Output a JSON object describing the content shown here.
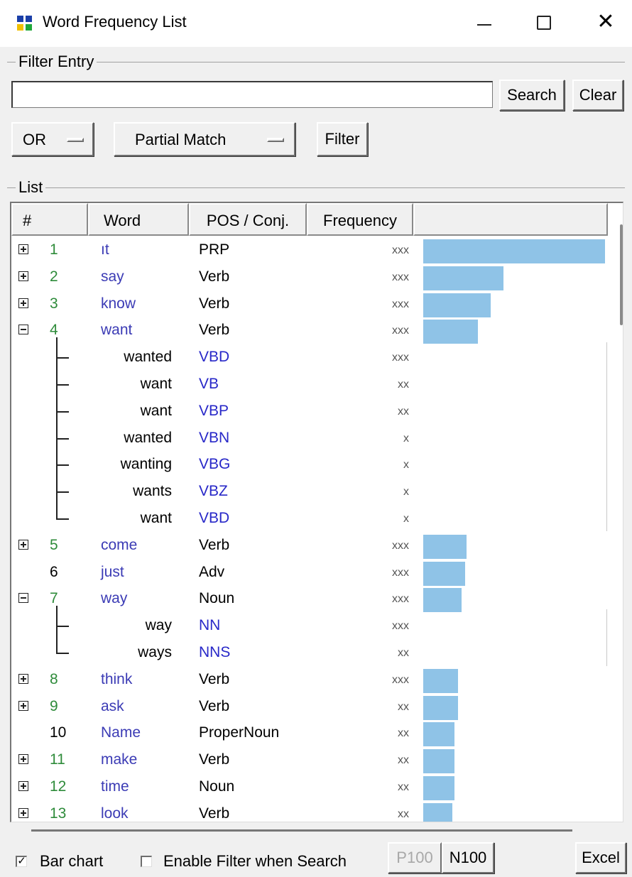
{
  "window": {
    "title": "Word Frequency List",
    "minimize": "minimize",
    "maximize": "maximize",
    "close_glyph": "✕"
  },
  "filter": {
    "group_label": "Filter Entry",
    "search_value": "",
    "search_label": "Search",
    "clear_label": "Clear",
    "logic_value": "OR",
    "match_value": "Partial Match",
    "filter_label": "Filter"
  },
  "list": {
    "group_label": "List",
    "columns": [
      "#",
      "Word",
      "POS / Conj.",
      "Frequency",
      ""
    ],
    "rows": [
      {
        "num": "1",
        "word": "ıt",
        "pos": "PRP",
        "freq": "xxx",
        "bar": 1.0,
        "expander": "plus"
      },
      {
        "num": "2",
        "word": "say",
        "pos": "Verb",
        "freq": "xxx",
        "bar": 0.44,
        "expander": "plus"
      },
      {
        "num": "3",
        "word": "know",
        "pos": "Verb",
        "freq": "xxx",
        "bar": 0.37,
        "expander": "plus"
      },
      {
        "num": "4",
        "word": "want",
        "pos": "Verb",
        "freq": "xxx",
        "bar": 0.3,
        "expander": "minus"
      },
      {
        "child": true,
        "word": "wanted",
        "pos": "VBD",
        "freq": "xxx"
      },
      {
        "child": true,
        "word": "want",
        "pos": "VB",
        "freq": "xx"
      },
      {
        "child": true,
        "word": "want",
        "pos": "VBP",
        "freq": "xx"
      },
      {
        "child": true,
        "word": "wanted",
        "pos": "VBN",
        "freq": "x"
      },
      {
        "child": true,
        "word": "wanting",
        "pos": "VBG",
        "freq": "x"
      },
      {
        "child": true,
        "word": "wants",
        "pos": "VBZ",
        "freq": "x"
      },
      {
        "child": true,
        "word": "want",
        "pos": "VBD",
        "freq": "x",
        "last": true
      },
      {
        "num": "5",
        "word": "come",
        "pos": "Verb",
        "freq": "xxx",
        "bar": 0.24,
        "expander": "plus"
      },
      {
        "num": "6",
        "word": "just",
        "pos": "Adv",
        "freq": "xxx",
        "bar": 0.23,
        "expander": ""
      },
      {
        "num": "7",
        "word": "way",
        "pos": "Noun",
        "freq": "xxx",
        "bar": 0.21,
        "expander": "minus"
      },
      {
        "child": true,
        "word": "way",
        "pos": "NN",
        "freq": "xxx"
      },
      {
        "child": true,
        "word": "ways",
        "pos": "NNS",
        "freq": "xx",
        "last": true
      },
      {
        "num": "8",
        "word": "think",
        "pos": "Verb",
        "freq": "xxx",
        "bar": 0.19,
        "expander": "plus"
      },
      {
        "num": "9",
        "word": "ask",
        "pos": "Verb",
        "freq": "xx",
        "bar": 0.19,
        "expander": "plus"
      },
      {
        "num": "10",
        "word": "Name",
        "pos": "ProperNoun",
        "freq": "xx",
        "bar": 0.17,
        "expander": ""
      },
      {
        "num": "11",
        "word": "make",
        "pos": "Verb",
        "freq": "xx",
        "bar": 0.17,
        "expander": "plus"
      },
      {
        "num": "12",
        "word": "time",
        "pos": "Noun",
        "freq": "xx",
        "bar": 0.17,
        "expander": "plus"
      },
      {
        "num": "13",
        "word": "look",
        "pos": "Verb",
        "freq": "xx",
        "bar": 0.16,
        "expander": "plus"
      }
    ]
  },
  "footer": {
    "bar_chart_label": "Bar chart",
    "bar_chart_checked": true,
    "enable_filter_label": "Enable Filter when Search",
    "enable_filter_checked": false,
    "p100_label": "P100",
    "n100_label": "N100",
    "excel_label": "Excel"
  },
  "colors": {
    "bar": "#8fc3e7",
    "number_green": "#2e8b3a",
    "word_blue": "#3b3bb5",
    "pos_blue": "#2828c8"
  }
}
